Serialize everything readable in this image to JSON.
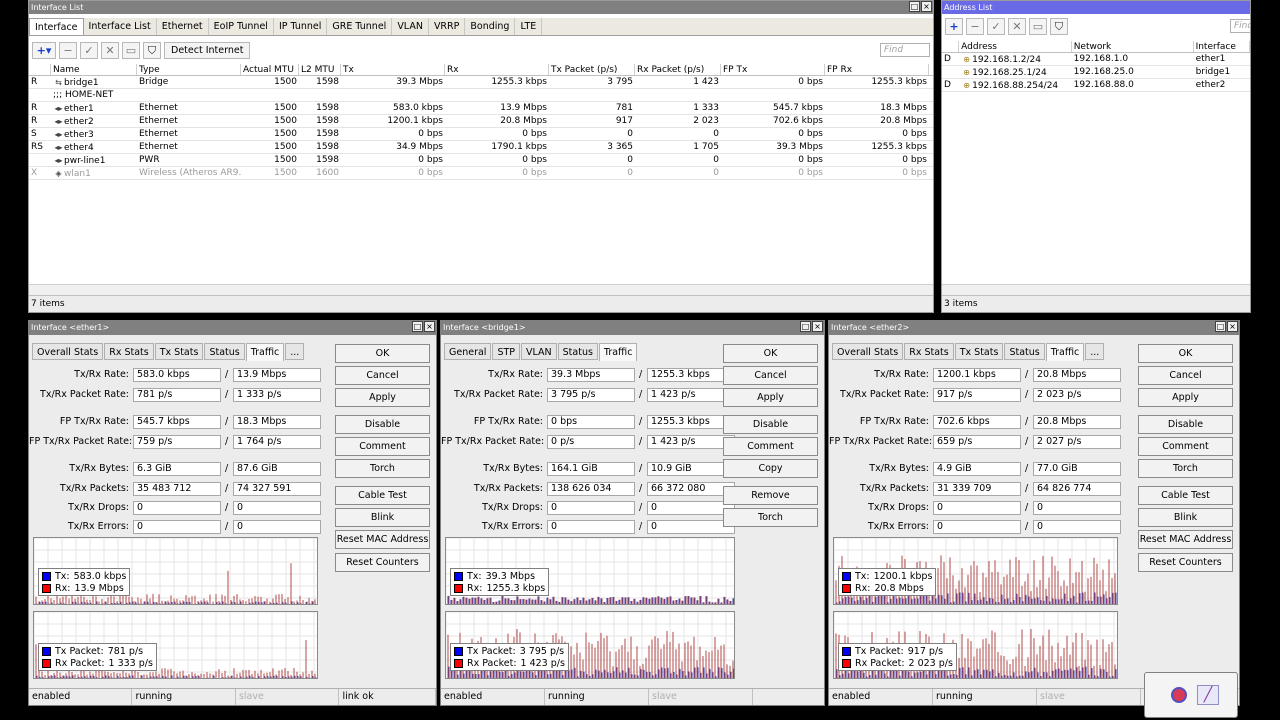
{
  "interface_list": {
    "title": "Interface List",
    "tabs": [
      "Interface",
      "Interface List",
      "Ethernet",
      "EoIP Tunnel",
      "IP Tunnel",
      "GRE Tunnel",
      "VLAN",
      "VRRP",
      "Bonding",
      "LTE"
    ],
    "detect_label": "Detect Internet",
    "find_placeholder": "Find",
    "columns": [
      "",
      "Name",
      "Type",
      "Actual MTU",
      "L2 MTU",
      "Tx",
      "Rx",
      "Tx Packet (p/s)",
      "Rx Packet (p/s)",
      "FP Tx",
      "FP Rx"
    ],
    "rows": [
      {
        "flag": "R",
        "icon": "bridge-icon",
        "name": "bridge1",
        "type": "Bridge",
        "mtu": "1500",
        "l2mtu": "1598",
        "tx": "39.3 Mbps",
        "rx": "1255.3 kbps",
        "txp": "3 795",
        "rxp": "1 423",
        "fptx": "0 bps",
        "fprx": "1255.3 kbps",
        "disabled": false
      },
      {
        "flag": "",
        "icon": "",
        "name": ";;; HOME-NET",
        "type": "",
        "mtu": "",
        "l2mtu": "",
        "tx": "",
        "rx": "",
        "txp": "",
        "rxp": "",
        "fptx": "",
        "fprx": "",
        "disabled": false
      },
      {
        "flag": "R",
        "icon": "ethernet-icon",
        "name": "ether1",
        "type": "Ethernet",
        "mtu": "1500",
        "l2mtu": "1598",
        "tx": "583.0 kbps",
        "rx": "13.9 Mbps",
        "txp": "781",
        "rxp": "1 333",
        "fptx": "545.7 kbps",
        "fprx": "18.3 Mbps",
        "disabled": false
      },
      {
        "flag": "R",
        "icon": "ethernet-icon",
        "name": "ether2",
        "type": "Ethernet",
        "mtu": "1500",
        "l2mtu": "1598",
        "tx": "1200.1 kbps",
        "rx": "20.8 Mbps",
        "txp": "917",
        "rxp": "2 023",
        "fptx": "702.6 kbps",
        "fprx": "20.8 Mbps",
        "disabled": false
      },
      {
        "flag": "S",
        "icon": "ethernet-icon",
        "name": "ether3",
        "type": "Ethernet",
        "mtu": "1500",
        "l2mtu": "1598",
        "tx": "0 bps",
        "rx": "0 bps",
        "txp": "0",
        "rxp": "0",
        "fptx": "0 bps",
        "fprx": "0 bps",
        "disabled": false
      },
      {
        "flag": "RS",
        "icon": "ethernet-icon",
        "name": "ether4",
        "type": "Ethernet",
        "mtu": "1500",
        "l2mtu": "1598",
        "tx": "34.9 Mbps",
        "rx": "1790.1 kbps",
        "txp": "3 365",
        "rxp": "1 705",
        "fptx": "39.3 Mbps",
        "fprx": "1255.3 kbps",
        "disabled": false
      },
      {
        "flag": "",
        "icon": "ethernet-icon",
        "name": "pwr-line1",
        "type": "PWR",
        "mtu": "1500",
        "l2mtu": "1598",
        "tx": "0 bps",
        "rx": "0 bps",
        "txp": "0",
        "rxp": "0",
        "fptx": "0 bps",
        "fprx": "0 bps",
        "disabled": false
      },
      {
        "flag": "X",
        "icon": "wireless-icon",
        "name": "wlan1",
        "type": "Wireless (Atheros AR9...",
        "mtu": "1500",
        "l2mtu": "1600",
        "tx": "0 bps",
        "rx": "0 bps",
        "txp": "0",
        "rxp": "0",
        "fptx": "0 bps",
        "fprx": "0 bps",
        "disabled": true
      }
    ],
    "count": "7 items"
  },
  "address_list": {
    "title": "Address List",
    "find_placeholder": "Find",
    "columns": [
      "",
      "Address",
      "Network",
      "Interface"
    ],
    "rows": [
      {
        "flag": "D",
        "address": "192.168.1.2/24",
        "network": "192.168.1.0",
        "interface": "ether1"
      },
      {
        "flag": "",
        "address": "192.168.25.1/24",
        "network": "192.168.25.0",
        "interface": "bridge1"
      },
      {
        "flag": "D",
        "address": "192.168.88.254/24",
        "network": "192.168.88.0",
        "interface": "ether2"
      }
    ],
    "count": "3 items"
  },
  "iface_windows": [
    {
      "title": "Interface <ether1>",
      "tabs": [
        "Overall Stats",
        "Rx Stats",
        "Tx Stats",
        "Status",
        "Traffic",
        "..."
      ],
      "active_tab": 4,
      "fields": [
        {
          "label": "Tx/Rx Rate:",
          "a": "583.0 kbps",
          "b": "13.9 Mbps"
        },
        {
          "label": "Tx/Rx Packet Rate:",
          "a": "781 p/s",
          "b": "1 333 p/s"
        },
        {
          "label": "FP Tx/Rx Rate:",
          "a": "545.7 kbps",
          "b": "18.3 Mbps"
        },
        {
          "label": "FP Tx/Rx Packet Rate:",
          "a": "759 p/s",
          "b": "1 764 p/s"
        },
        {
          "label": "Tx/Rx Bytes:",
          "a": "6.3 GiB",
          "b": "87.6 GiB"
        },
        {
          "label": "Tx/Rx Packets:",
          "a": "35 483 712",
          "b": "74 327 591"
        },
        {
          "label": "Tx/Rx Drops:",
          "a": "0",
          "b": "0"
        },
        {
          "label": "Tx/Rx Errors:",
          "a": "0",
          "b": "0"
        }
      ],
      "buttons": [
        "OK",
        "Cancel",
        "Apply",
        "Disable",
        "Comment",
        "Torch",
        "Cable Test",
        "Blink",
        "Reset MAC Address",
        "Reset Counters"
      ],
      "legend_rate": [
        {
          "label": "Tx:",
          "value": "583.0 kbps",
          "color": "#0000ff"
        },
        {
          "label": "Rx:",
          "value": "13.9 Mbps",
          "color": "#ff0000"
        }
      ],
      "legend_packet": [
        {
          "label": "Tx Packet:",
          "value": "781 p/s",
          "color": "#0000ff"
        },
        {
          "label": "Rx Packet:",
          "value": "1 333 p/s",
          "color": "#ff0000"
        }
      ],
      "status": [
        "enabled",
        "running",
        "slave",
        "link ok"
      ]
    },
    {
      "title": "Interface <bridge1>",
      "tabs": [
        "General",
        "STP",
        "VLAN",
        "Status",
        "Traffic"
      ],
      "active_tab": 4,
      "fields": [
        {
          "label": "Tx/Rx Rate:",
          "a": "39.3 Mbps",
          "b": "1255.3 kbps"
        },
        {
          "label": "Tx/Rx Packet Rate:",
          "a": "3 795 p/s",
          "b": "1 423 p/s"
        },
        {
          "label": "FP Tx/Rx Rate:",
          "a": "0 bps",
          "b": "1255.3 kbps"
        },
        {
          "label": "FP Tx/Rx Packet Rate:",
          "a": "0 p/s",
          "b": "1 423 p/s"
        },
        {
          "label": "Tx/Rx Bytes:",
          "a": "164.1 GiB",
          "b": "10.9 GiB"
        },
        {
          "label": "Tx/Rx Packets:",
          "a": "138 626 034",
          "b": "66 372 080"
        },
        {
          "label": "Tx/Rx Drops:",
          "a": "0",
          "b": "0"
        },
        {
          "label": "Tx/Rx Errors:",
          "a": "0",
          "b": "0"
        }
      ],
      "buttons": [
        "OK",
        "Cancel",
        "Apply",
        "Disable",
        "Comment",
        "Copy",
        "Remove",
        "Torch"
      ],
      "legend_rate": [
        {
          "label": "Tx:",
          "value": "39.3 Mbps",
          "color": "#0000ff"
        },
        {
          "label": "Rx:",
          "value": "1255.3 kbps",
          "color": "#ff0000"
        }
      ],
      "legend_packet": [
        {
          "label": "Tx Packet:",
          "value": "3 795 p/s",
          "color": "#0000ff"
        },
        {
          "label": "Rx Packet:",
          "value": "1 423 p/s",
          "color": "#ff0000"
        }
      ],
      "status": [
        "enabled",
        "running",
        "slave"
      ]
    },
    {
      "title": "Interface <ether2>",
      "tabs": [
        "Overall Stats",
        "Rx Stats",
        "Tx Stats",
        "Status",
        "Traffic",
        "..."
      ],
      "active_tab": 4,
      "fields": [
        {
          "label": "Tx/Rx Rate:",
          "a": "1200.1 kbps",
          "b": "20.8 Mbps"
        },
        {
          "label": "Tx/Rx Packet Rate:",
          "a": "917 p/s",
          "b": "2 023 p/s"
        },
        {
          "label": "FP Tx/Rx Rate:",
          "a": "702.6 kbps",
          "b": "20.8 Mbps"
        },
        {
          "label": "FP Tx/Rx Packet Rate:",
          "a": "659 p/s",
          "b": "2 027 p/s"
        },
        {
          "label": "Tx/Rx Bytes:",
          "a": "4.9 GiB",
          "b": "77.0 GiB"
        },
        {
          "label": "Tx/Rx Packets:",
          "a": "31 339 709",
          "b": "64 826 774"
        },
        {
          "label": "Tx/Rx Drops:",
          "a": "0",
          "b": "0"
        },
        {
          "label": "Tx/Rx Errors:",
          "a": "0",
          "b": "0"
        }
      ],
      "buttons": [
        "OK",
        "Cancel",
        "Apply",
        "Disable",
        "Comment",
        "Torch",
        "Cable Test",
        "Blink",
        "Reset MAC Address",
        "Reset Counters"
      ],
      "legend_rate": [
        {
          "label": "Tx:",
          "value": "1200.1 kbps",
          "color": "#0000ff"
        },
        {
          "label": "Rx:",
          "value": "20.8 Mbps",
          "color": "#ff0000"
        }
      ],
      "legend_packet": [
        {
          "label": "Tx Packet:",
          "value": "917 p/s",
          "color": "#0000ff"
        },
        {
          "label": "Rx Packet:",
          "value": "2 023 p/s",
          "color": "#ff0000"
        }
      ],
      "status": [
        "enabled",
        "running",
        "slave"
      ]
    }
  ],
  "colors": {
    "tx": "#0000ff",
    "rx": "#ff0000",
    "tx_bar": "#3a3aa8",
    "rx_bar": "#b04848"
  },
  "icons": {
    "add": "plus-icon",
    "remove": "minus-icon",
    "enable": "check-icon",
    "disable": "cross-icon",
    "comment": "note-icon",
    "filter": "filter-icon"
  }
}
